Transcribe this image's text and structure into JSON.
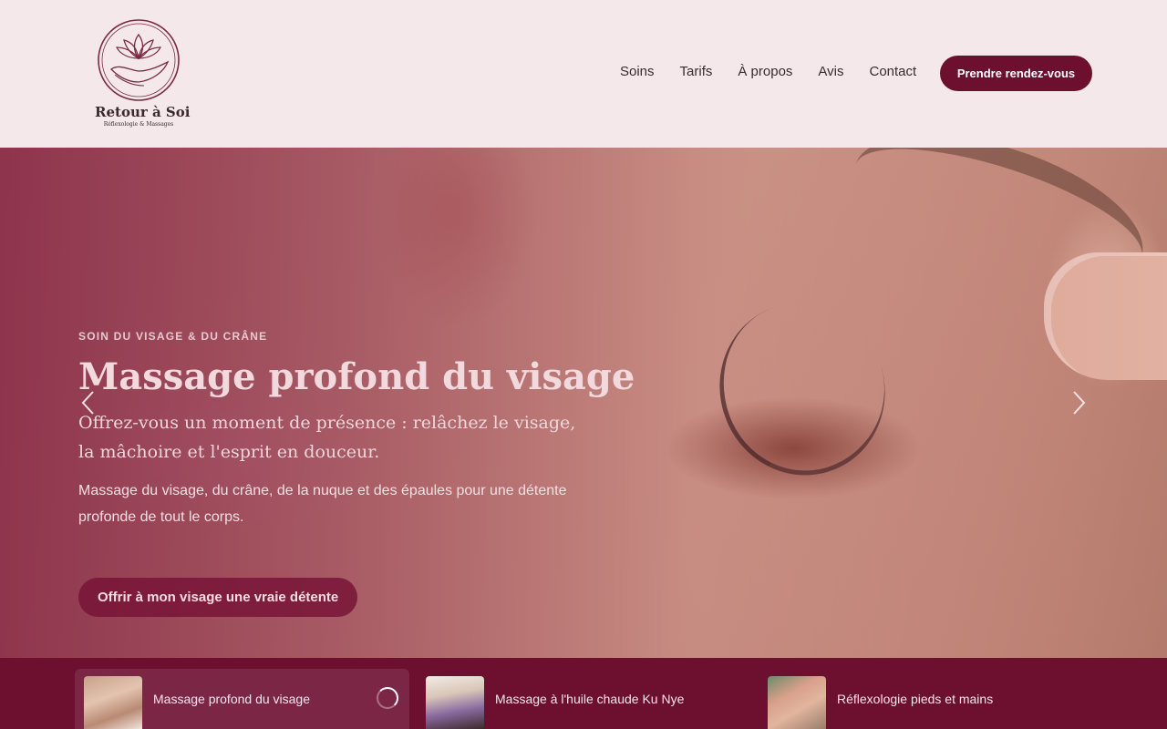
{
  "brand": {
    "name": "Retour à Soi",
    "tagline": "Réflexologie & Massages",
    "colors": {
      "primary": "#6d0f2e",
      "background": "#f4e8ea"
    }
  },
  "nav": {
    "items": [
      {
        "label": "Soins"
      },
      {
        "label": "Tarifs"
      },
      {
        "label": "À propos"
      },
      {
        "label": "Avis"
      },
      {
        "label": "Contact"
      }
    ],
    "cta_label": "Prendre rendez-vous"
  },
  "hero": {
    "eyebrow": "SOIN DU VISAGE & DU CRÂNE",
    "title": "Massage profond du visage",
    "lead": "Offrez-vous un moment de présence : relâchez le visage, la mâchoire et l'esprit en douceur.",
    "description": "Massage du visage, du crâne, de la nuque et des épaules pour une détente profonde de tout le corps.",
    "cta_label": "Offrir à mon visage une vraie détente",
    "prev_icon": "chevron-left-icon",
    "next_icon": "chevron-right-icon"
  },
  "slides": [
    {
      "label": "Massage profond du visage",
      "active": true
    },
    {
      "label": "Massage à l'huile chaude Ku Nye",
      "active": false
    },
    {
      "label": "Réflexologie pieds et mains",
      "active": false
    }
  ]
}
